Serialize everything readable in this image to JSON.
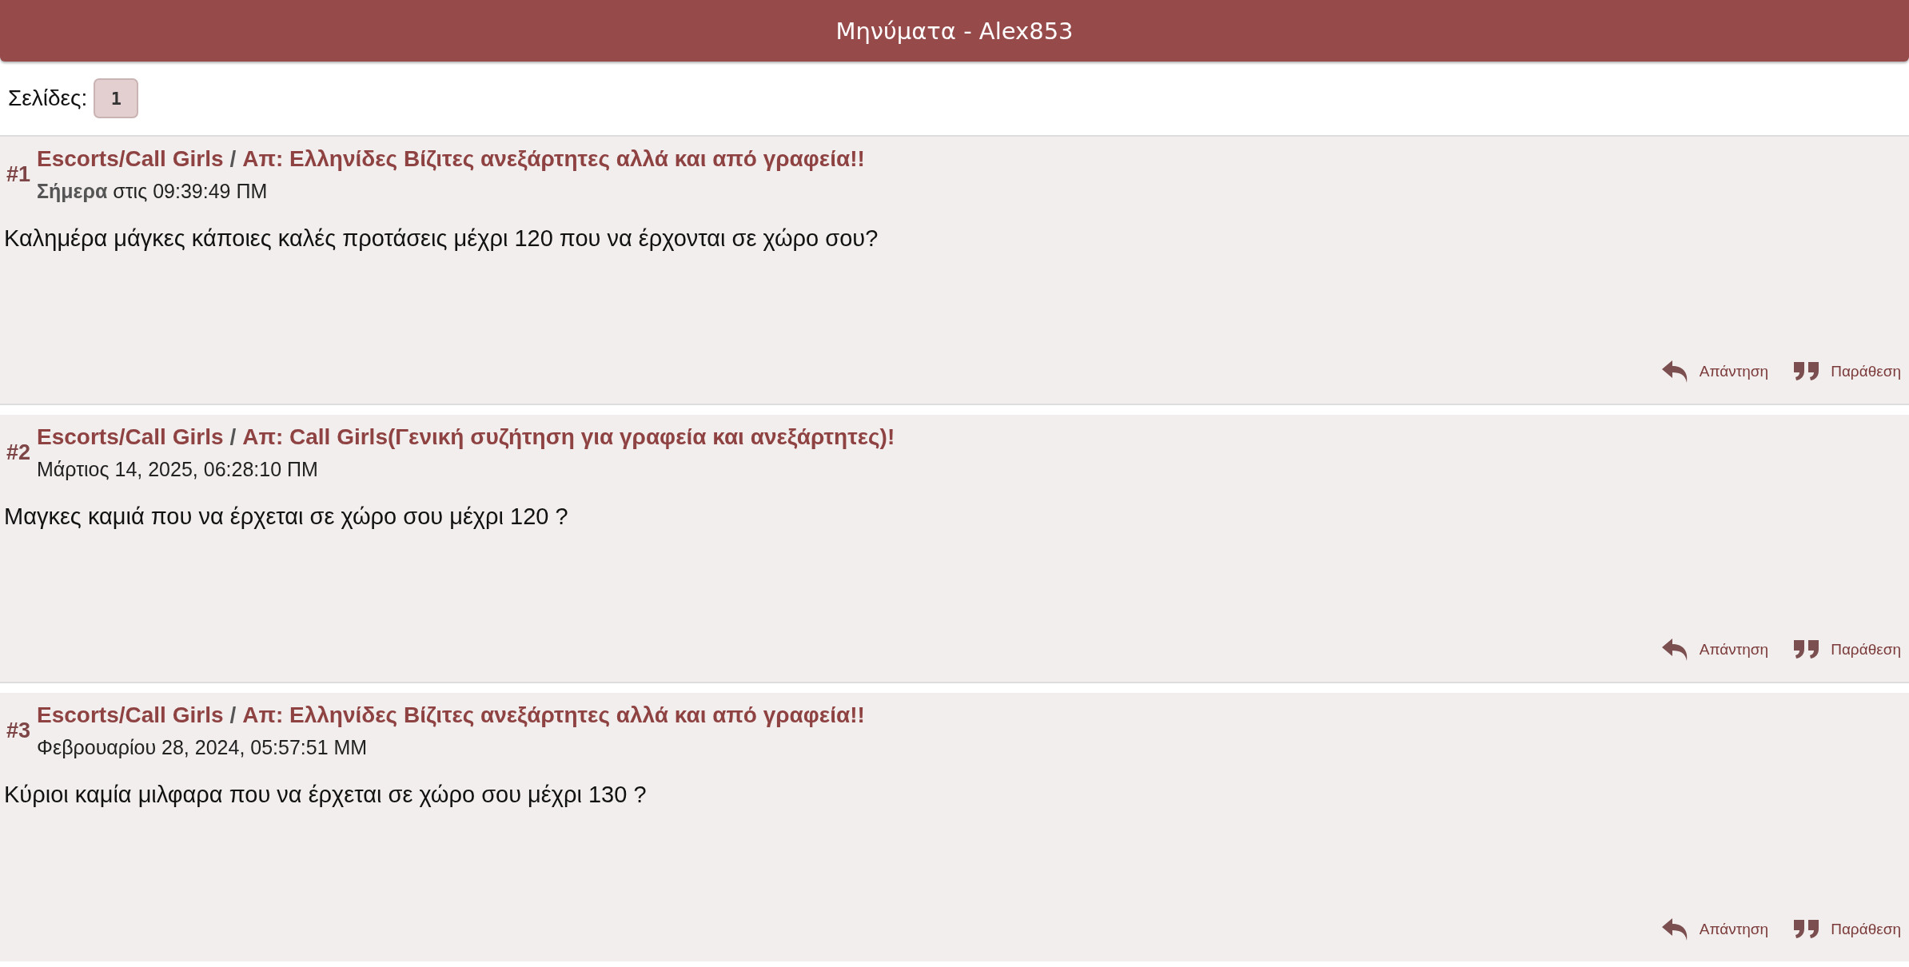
{
  "header": {
    "title": "Μηνύματα - Alex853"
  },
  "pagination": {
    "label": "Σελίδες:",
    "pages": [
      {
        "label": "1",
        "selected": true
      }
    ]
  },
  "posts": [
    {
      "number": "#1",
      "board": "Escorts/Call Girls",
      "separator": "/",
      "topic": "Απ: Ελληνίδες Βίζιτες ανεξάρτητες αλλά και από γραφεία!!",
      "date": "**Σήμερα** στις 09:39:49 ΠΜ",
      "body": "Καλημέρα μάγκες κάποιες καλές προτάσεις μέχρι 120 που να έρχονται σε χώρο σου?",
      "actions": [
        {
          "kind": "reply",
          "label": "Απάντηση"
        },
        {
          "kind": "quote",
          "label": "Παράθεση"
        }
      ]
    },
    {
      "number": "#2",
      "board": "Escorts/Call Girls",
      "separator": "/",
      "topic": "Απ: Call Girls(Γενική συζήτηση για γραφεία και ανεξάρτητες)!",
      "date": "Μάρτιος 14, 2025, 06:28:10 ΠΜ",
      "body": "Μαγκες καμιά που να έρχεται σε χώρο σου μέχρι 120 ?",
      "actions": [
        {
          "kind": "reply",
          "label": "Απάντηση"
        },
        {
          "kind": "quote",
          "label": "Παράθεση"
        }
      ]
    },
    {
      "number": "#3",
      "board": "Escorts/Call Girls",
      "separator": "/",
      "topic": "Απ: Ελληνίδες Βίζιτες ανεξάρτητες αλλά και από γραφεία!!",
      "date": "Φεβρουαρίου 28, 2024, 05:57:51 ΜΜ",
      "body": "Κύριοι καμία μιλφαρα που να έρχεται σε χώρο σου μέχρι 130 ?",
      "actions": [
        {
          "kind": "reply",
          "label": "Απάντηση"
        },
        {
          "kind": "quote",
          "label": "Παράθεση"
        }
      ]
    }
  ]
}
